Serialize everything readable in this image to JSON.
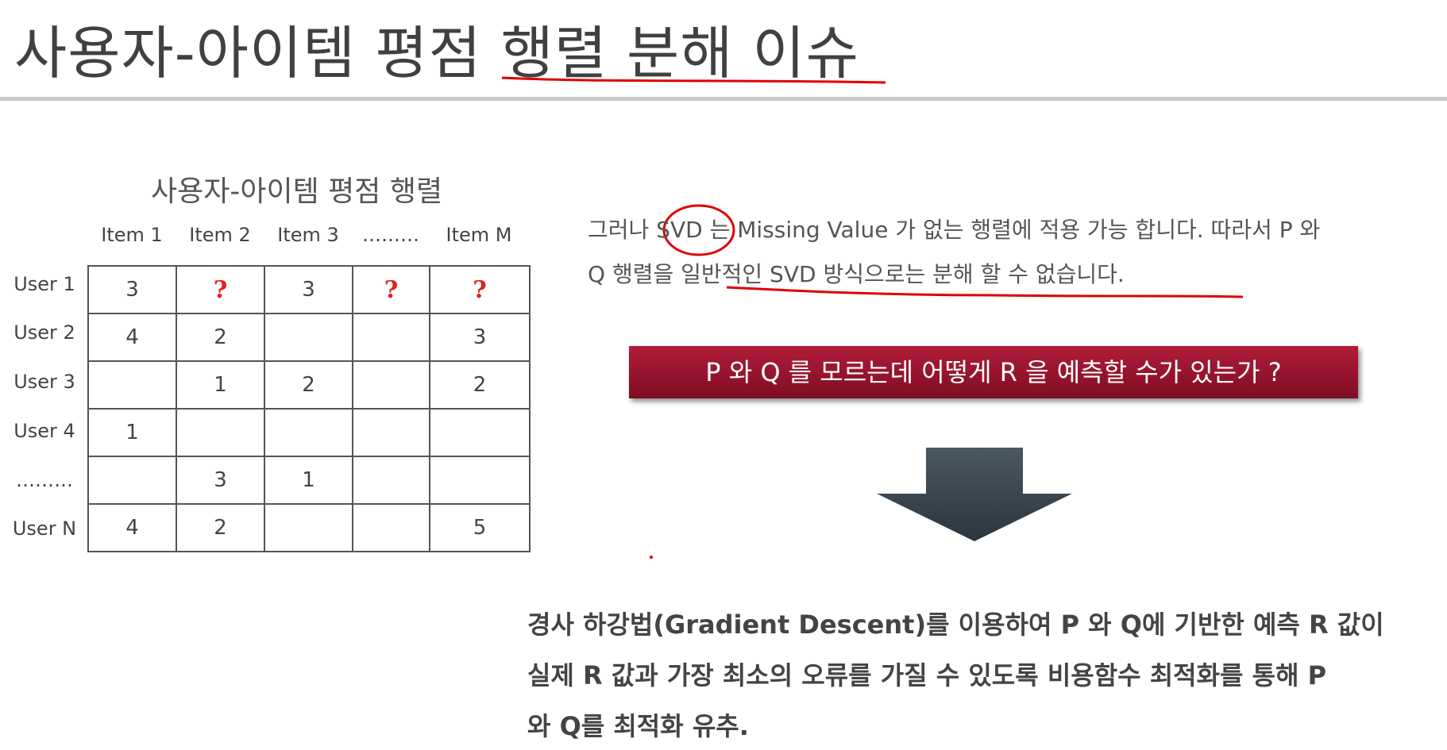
{
  "title": "사용자-아이템 평점 행렬 분해 이슈",
  "matrix": {
    "caption": "사용자-아이템 평점 행렬",
    "columns": [
      "Item 1",
      "Item 2",
      "Item 3",
      "………",
      "Item M"
    ],
    "rows": [
      {
        "label": "User 1",
        "cells": [
          "3",
          "?",
          "3",
          "?",
          "?"
        ]
      },
      {
        "label": "User 2",
        "cells": [
          "4",
          "2",
          "",
          "",
          "3"
        ]
      },
      {
        "label": "User 3",
        "cells": [
          "",
          "1",
          "2",
          "",
          "2"
        ]
      },
      {
        "label": "User 4",
        "cells": [
          "1",
          "",
          "",
          "",
          ""
        ]
      },
      {
        "label": "………",
        "cells": [
          "",
          "3",
          "1",
          "",
          ""
        ]
      },
      {
        "label": "User N",
        "cells": [
          "4",
          "2",
          "",
          "",
          "5"
        ]
      }
    ]
  },
  "explanation": {
    "line1": "그러나 SVD 는 Missing Value 가 없는 행렬에 적용 가능 합니다. 따라서 P 와",
    "line2": "Q 행렬을 일반적인 SVD 방식으로는 분해 할 수 없습니다."
  },
  "banner": "P 와 Q 를 모르는데 어떻게 R 을 예측할 수가 있는가 ?",
  "conclusion": {
    "line1": "경사 하강법(Gradient Descent)를 이용하여 P 와 Q에 기반한 예측 R 값이",
    "line2": "실제 R 값과 가장 최소의 오류를 가질 수 있도록 비용함수 최적화를 통해 P",
    "line3": "와 Q를 최적화 유추."
  },
  "colors": {
    "banner": "#9e1530",
    "question_mark": "#e02020",
    "annotation": "#e00000",
    "arrow": "#3d4b55"
  }
}
